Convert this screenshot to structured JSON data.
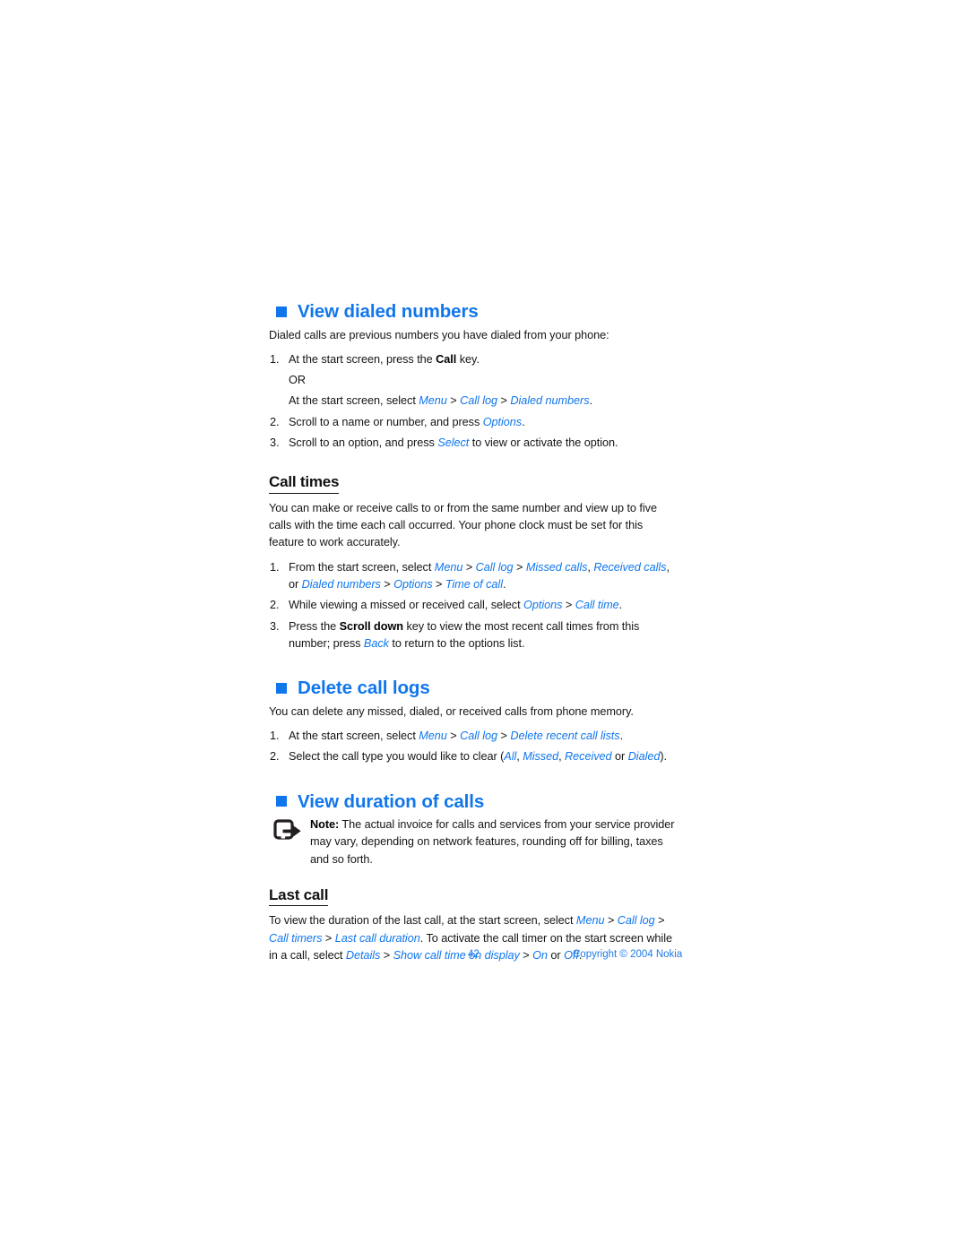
{
  "page": {
    "number": "42",
    "copyright": "Copyright © 2004 Nokia",
    "accent_color": "#1076EC",
    "footer_color": "#1E7BE8",
    "text_color": "#151515",
    "background": "#ffffff"
  },
  "sections": {
    "view_dialed_numbers": {
      "heading": "View dialed numbers",
      "bullet_icon": "filled-square-bullet",
      "intro": "Dialed calls are previous numbers you have dialed from your phone:",
      "step1": {
        "lead": "At the start screen, press the ",
        "key": "Call",
        "tail": " key.",
        "or": "OR",
        "alt_lead": "At the start screen, select ",
        "alt_menu": "Menu",
        "alt_calllog": "Call log",
        "alt_dialednumbers": "Dialed numbers",
        "alt_end": "."
      },
      "step2": {
        "lead": "Scroll to a name or number, and press ",
        "ui": "Options",
        "tail": "."
      },
      "step3": {
        "lead": "Scroll to an option, and press ",
        "ui": "Select",
        "tail": " to view or activate the option."
      }
    },
    "call_times": {
      "heading": "Call times",
      "intro": "You can make or receive calls to or from the same number and view up to five calls with the time each call occurred. Your phone clock must be set for this feature to work accurately.",
      "step1": {
        "lead": "From the start screen, select ",
        "menu": "Menu",
        "calllog": "Call log",
        "missed": "Missed calls",
        "received": "Received calls",
        "or": ", or ",
        "dialednumbers": "Dialed numbers",
        "options": "Options",
        "timeofcall": "Time of call",
        "end": "."
      },
      "step2": {
        "lead": "While viewing a missed or received call, select ",
        "options": "Options",
        "calltime": "Call time",
        "end": "."
      },
      "step3": {
        "lead": "Press the ",
        "key": "Scroll down",
        "mid": " key to view the most recent call times from this number; press ",
        "back": "Back",
        "tail": " to return to the options list."
      }
    },
    "delete_call_logs": {
      "heading": "Delete call logs",
      "bullet_icon": "filled-square-bullet",
      "intro": "You can delete any missed, dialed, or received calls from phone memory.",
      "step1": {
        "lead": "At the start screen, select ",
        "menu": "Menu",
        "calllog": "Call log",
        "deletelists": "Delete recent call lists",
        "end": "."
      },
      "step2": {
        "lead": "Select the call type you would like to clear (",
        "all": "All",
        "missed": "Missed",
        "received": "Received",
        "or": " or ",
        "dialed": "Dialed",
        "end": ")."
      }
    },
    "view_duration_of_calls": {
      "heading": "View duration of calls",
      "bullet_icon": "filled-square-bullet",
      "note": {
        "icon": "note-arrow-icon",
        "label": "Note:",
        "text": " The actual invoice for calls and services from your service provider may vary, depending on network features, rounding off for billing, taxes and so forth."
      }
    },
    "last_call": {
      "heading": "Last call",
      "body": {
        "lead": "To view the duration of the last call, at the start screen, select ",
        "menu": "Menu",
        "calllog": "Call log",
        "calltimers": "Call timers",
        "lastcallduration": "Last call duration",
        "mid": ". To activate the call timer on the start screen while in a call, select ",
        "details": "Details",
        "showcalltime": "Show call time on display",
        "on": "On",
        "or": " or ",
        "off": "Off",
        "end": "."
      }
    }
  }
}
